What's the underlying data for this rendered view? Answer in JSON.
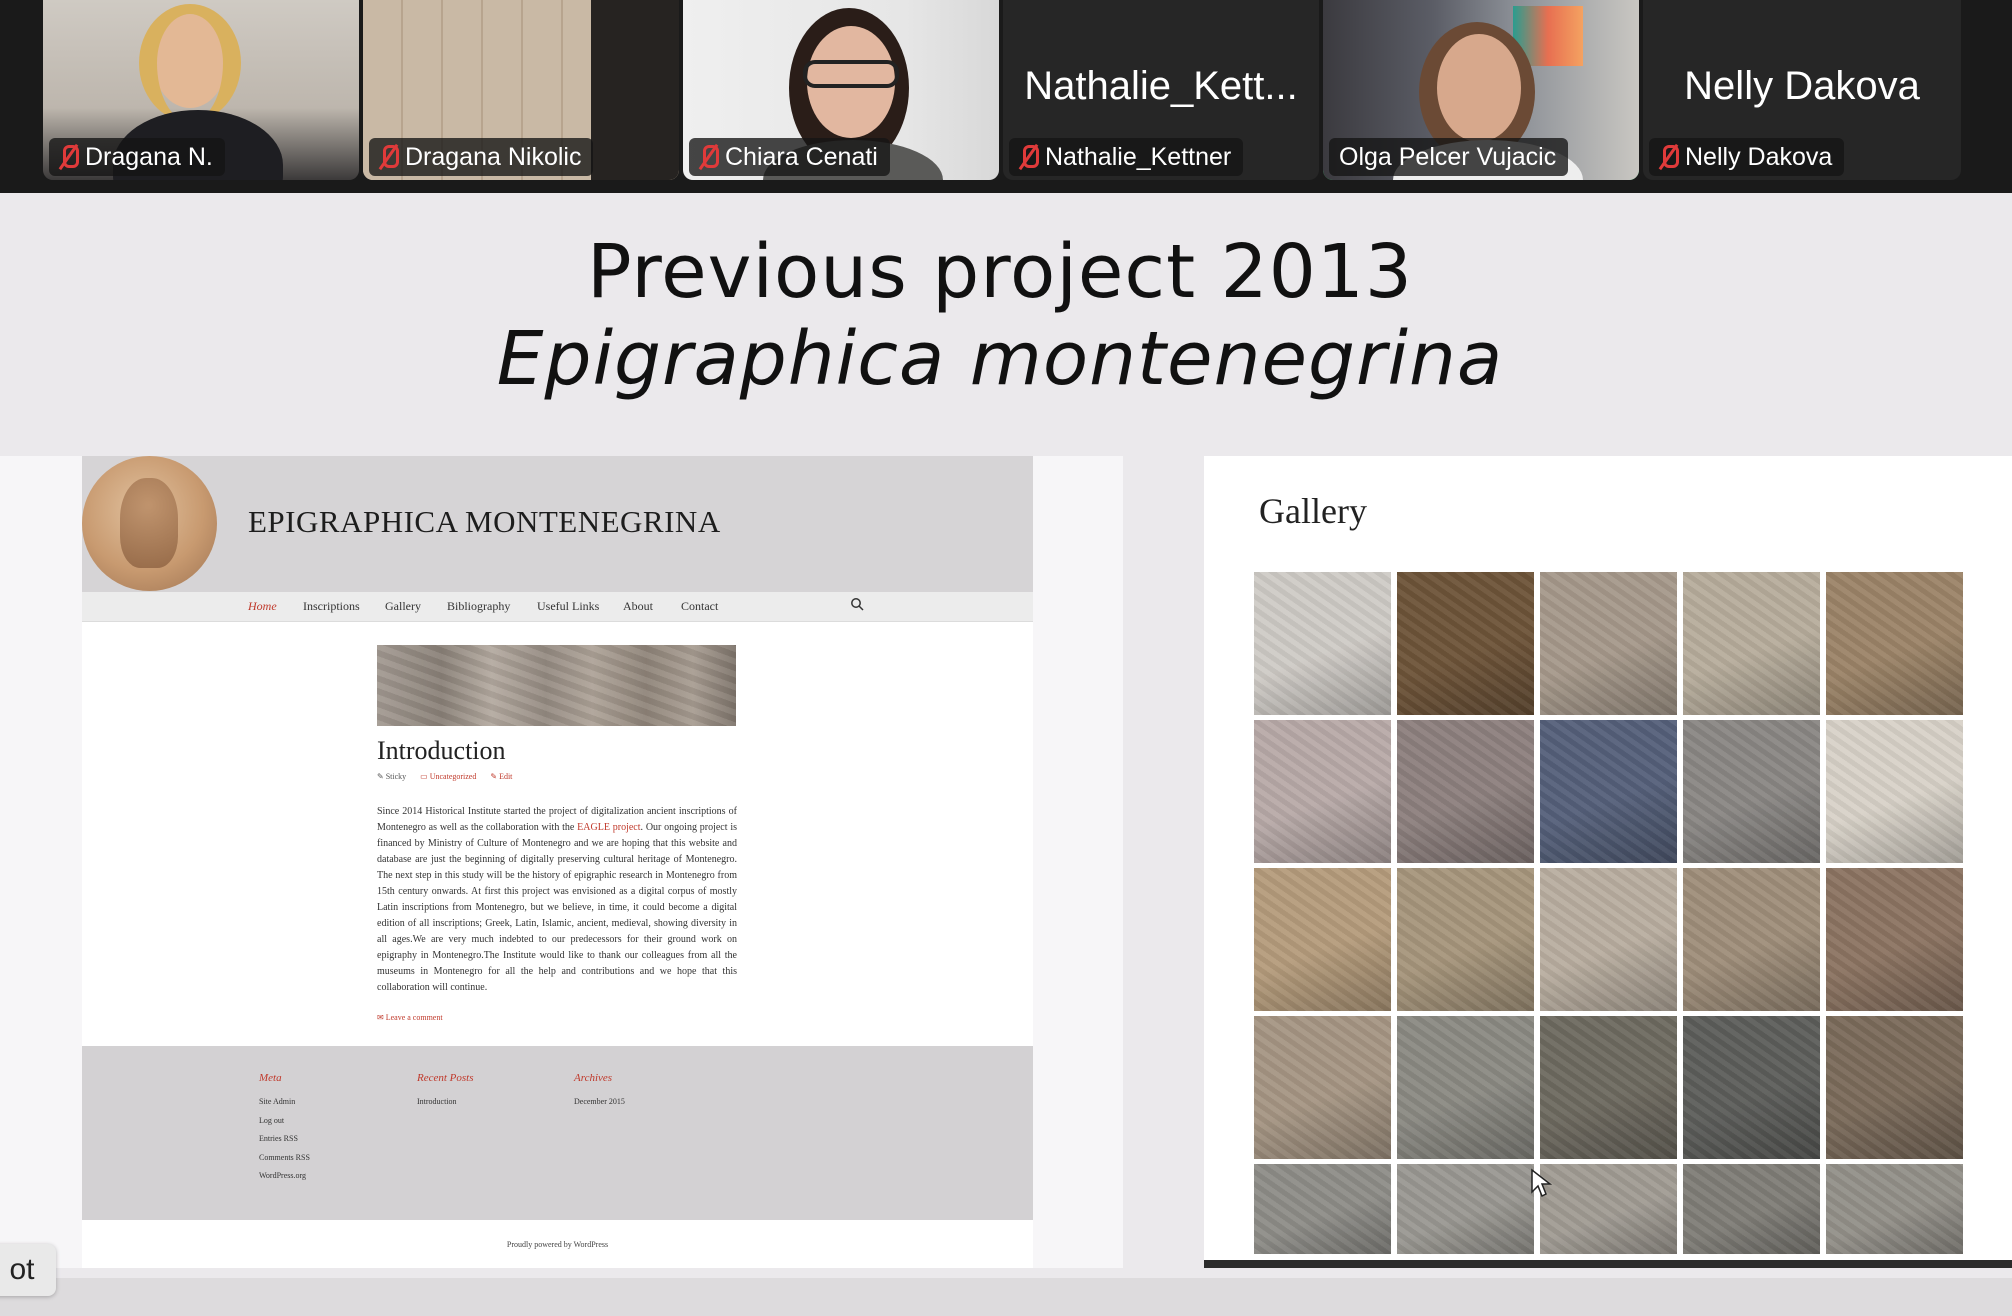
{
  "participants": [
    {
      "label": "Dragana N.",
      "muted": true,
      "big_name": ""
    },
    {
      "label": "Dragana Nikolic",
      "muted": true,
      "big_name": ""
    },
    {
      "label": "Chiara Cenati",
      "muted": true,
      "big_name": ""
    },
    {
      "label": "Nathalie_Kettner",
      "muted": true,
      "big_name": "Nathalie_Kett..."
    },
    {
      "label": "Olga Pelcer Vujacic",
      "muted": false,
      "big_name": "",
      "active_speaker": true
    },
    {
      "label": "Nelly Dakova",
      "muted": true,
      "big_name": "Nelly Dakova"
    }
  ],
  "slide": {
    "title_line1": "Previous project 2013",
    "title_line2": "Epigraphica montenegrina"
  },
  "website": {
    "site_name": "EPIGRAPHICA MONTENEGRINA",
    "nav": [
      "Home",
      "Inscriptions",
      "Gallery",
      "Bibliography",
      "Useful Links",
      "About",
      "Contact"
    ],
    "post_title": "Introduction",
    "post_meta": [
      "Sticky",
      "Uncategorized",
      "Edit"
    ],
    "body_before_link": "Since 2014 Historical Institute started the project of digitalization ancient inscriptions of Montenegro as well as the collaboration with the ",
    "body_link": "EAGLE project",
    "body_after_link": ". Our ongoing project is financed by Ministry of Culture of Montenegro and we are hoping that this website and database are just the beginning of digitally preserving cultural heritage of Montenegro. The next step in this study will be the history of epigraphic research in Montenegro from 15th century onwards. At first this project was envisioned as a digital corpus of mostly Latin inscriptions from Montenegro, but we believe, in time, it could become a digital edition of all inscriptions; Greek, Latin, Islamic, ancient, medieval, showing diversity in all ages.We are very much indebted to our predecessors for their ground work on epigraphy in Montenegro.The Institute would like to thank our colleagues from all the museums in Montenegro for all the help and contributions and we hope that this collaboration will continue.",
    "leave_comment": "Leave a comment",
    "footer": {
      "meta_title": "Meta",
      "meta_links": [
        "Site Admin",
        "Log out",
        "Entries RSS",
        "Comments RSS",
        "WordPress.org"
      ],
      "recent_title": "Recent Posts",
      "recent_links": [
        "Introduction"
      ],
      "archives_title": "Archives",
      "archives_links": [
        "December 2015"
      ]
    },
    "powered": "Proudly powered by WordPress"
  },
  "gallery": {
    "title": "Gallery",
    "thumb_colors": [
      "#cfcbc6",
      "#6e5439",
      "#a6998b",
      "#b7ad9c",
      "#9c8468",
      "#b8aaa8",
      "#8d807e",
      "#55607a",
      "#8a8784",
      "#d8d2c8",
      "#b59c7c",
      "#a7967c",
      "#b9aea0",
      "#9f8e7a",
      "#8c7462",
      "#a69684",
      "#8b8a83",
      "#6e6a60",
      "#5d5e5b",
      "#7b6b5b",
      "#8e8d88",
      "#9a9892",
      "#a19c94",
      "#7f7d77",
      "#939089"
    ]
  },
  "pill_text": "ot"
}
